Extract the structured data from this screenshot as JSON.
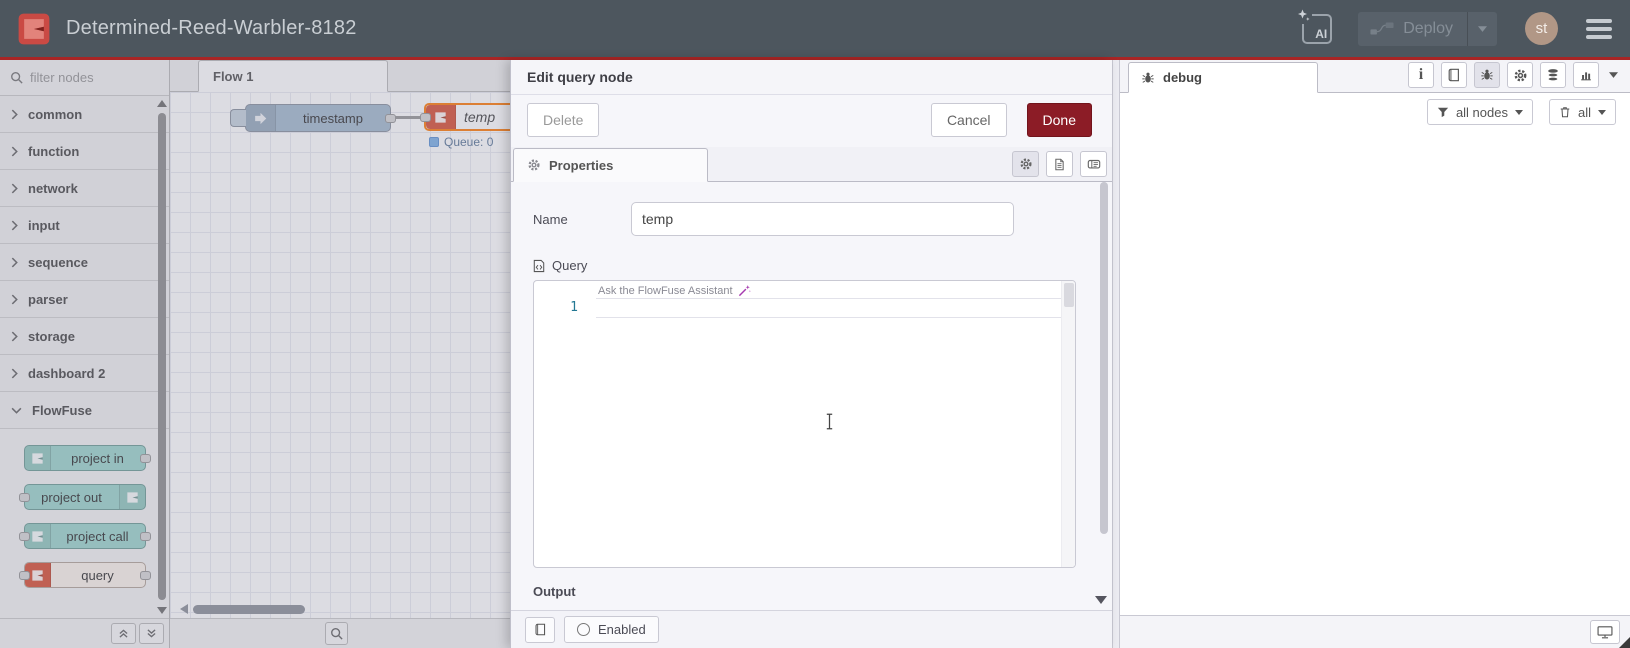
{
  "colors": {
    "header-bg": "#4d565e",
    "header-red": "#a92525",
    "done-red": "#8c1c26",
    "node-teal": "#9ed6cd",
    "node-gray": "#a6bbcf",
    "selected-orange": "#ff7f0e",
    "flowfuse-red": "#d9543a",
    "status-blue": "#7fb2e6"
  },
  "header": {
    "title": "Determined-Reed-Warbler-8182",
    "ai_button_label": "AI",
    "deploy_label": "Deploy",
    "avatar_initials": "st"
  },
  "palette": {
    "filter_placeholder": "filter nodes",
    "categories": [
      {
        "label": "common"
      },
      {
        "label": "function"
      },
      {
        "label": "network"
      },
      {
        "label": "input"
      },
      {
        "label": "sequence"
      },
      {
        "label": "parser"
      },
      {
        "label": "storage"
      },
      {
        "label": "dashboard 2"
      },
      {
        "label": "FlowFuse"
      }
    ],
    "flowfuse_nodes": [
      {
        "label": "project in"
      },
      {
        "label": "project out"
      },
      {
        "label": "project call"
      },
      {
        "label": "query"
      }
    ]
  },
  "canvas": {
    "tab_label": "Flow 1",
    "inject_node_label": "timestamp",
    "query_node_label": "temp",
    "query_node_status": "Queue: 0"
  },
  "tray": {
    "title": "Edit query node",
    "delete_label": "Delete",
    "cancel_label": "Cancel",
    "done_label": "Done",
    "properties_tab_label": "Properties",
    "name_label": "Name",
    "name_value": "temp",
    "query_label": "Query",
    "editor": {
      "line_number": "1",
      "assistant_placeholder": "Ask the FlowFuse Assistant"
    },
    "output_label": "Output",
    "enabled_label": "Enabled"
  },
  "debug": {
    "tab_label": "debug",
    "filter_button_label": "all nodes",
    "clear_button_label": "all"
  }
}
